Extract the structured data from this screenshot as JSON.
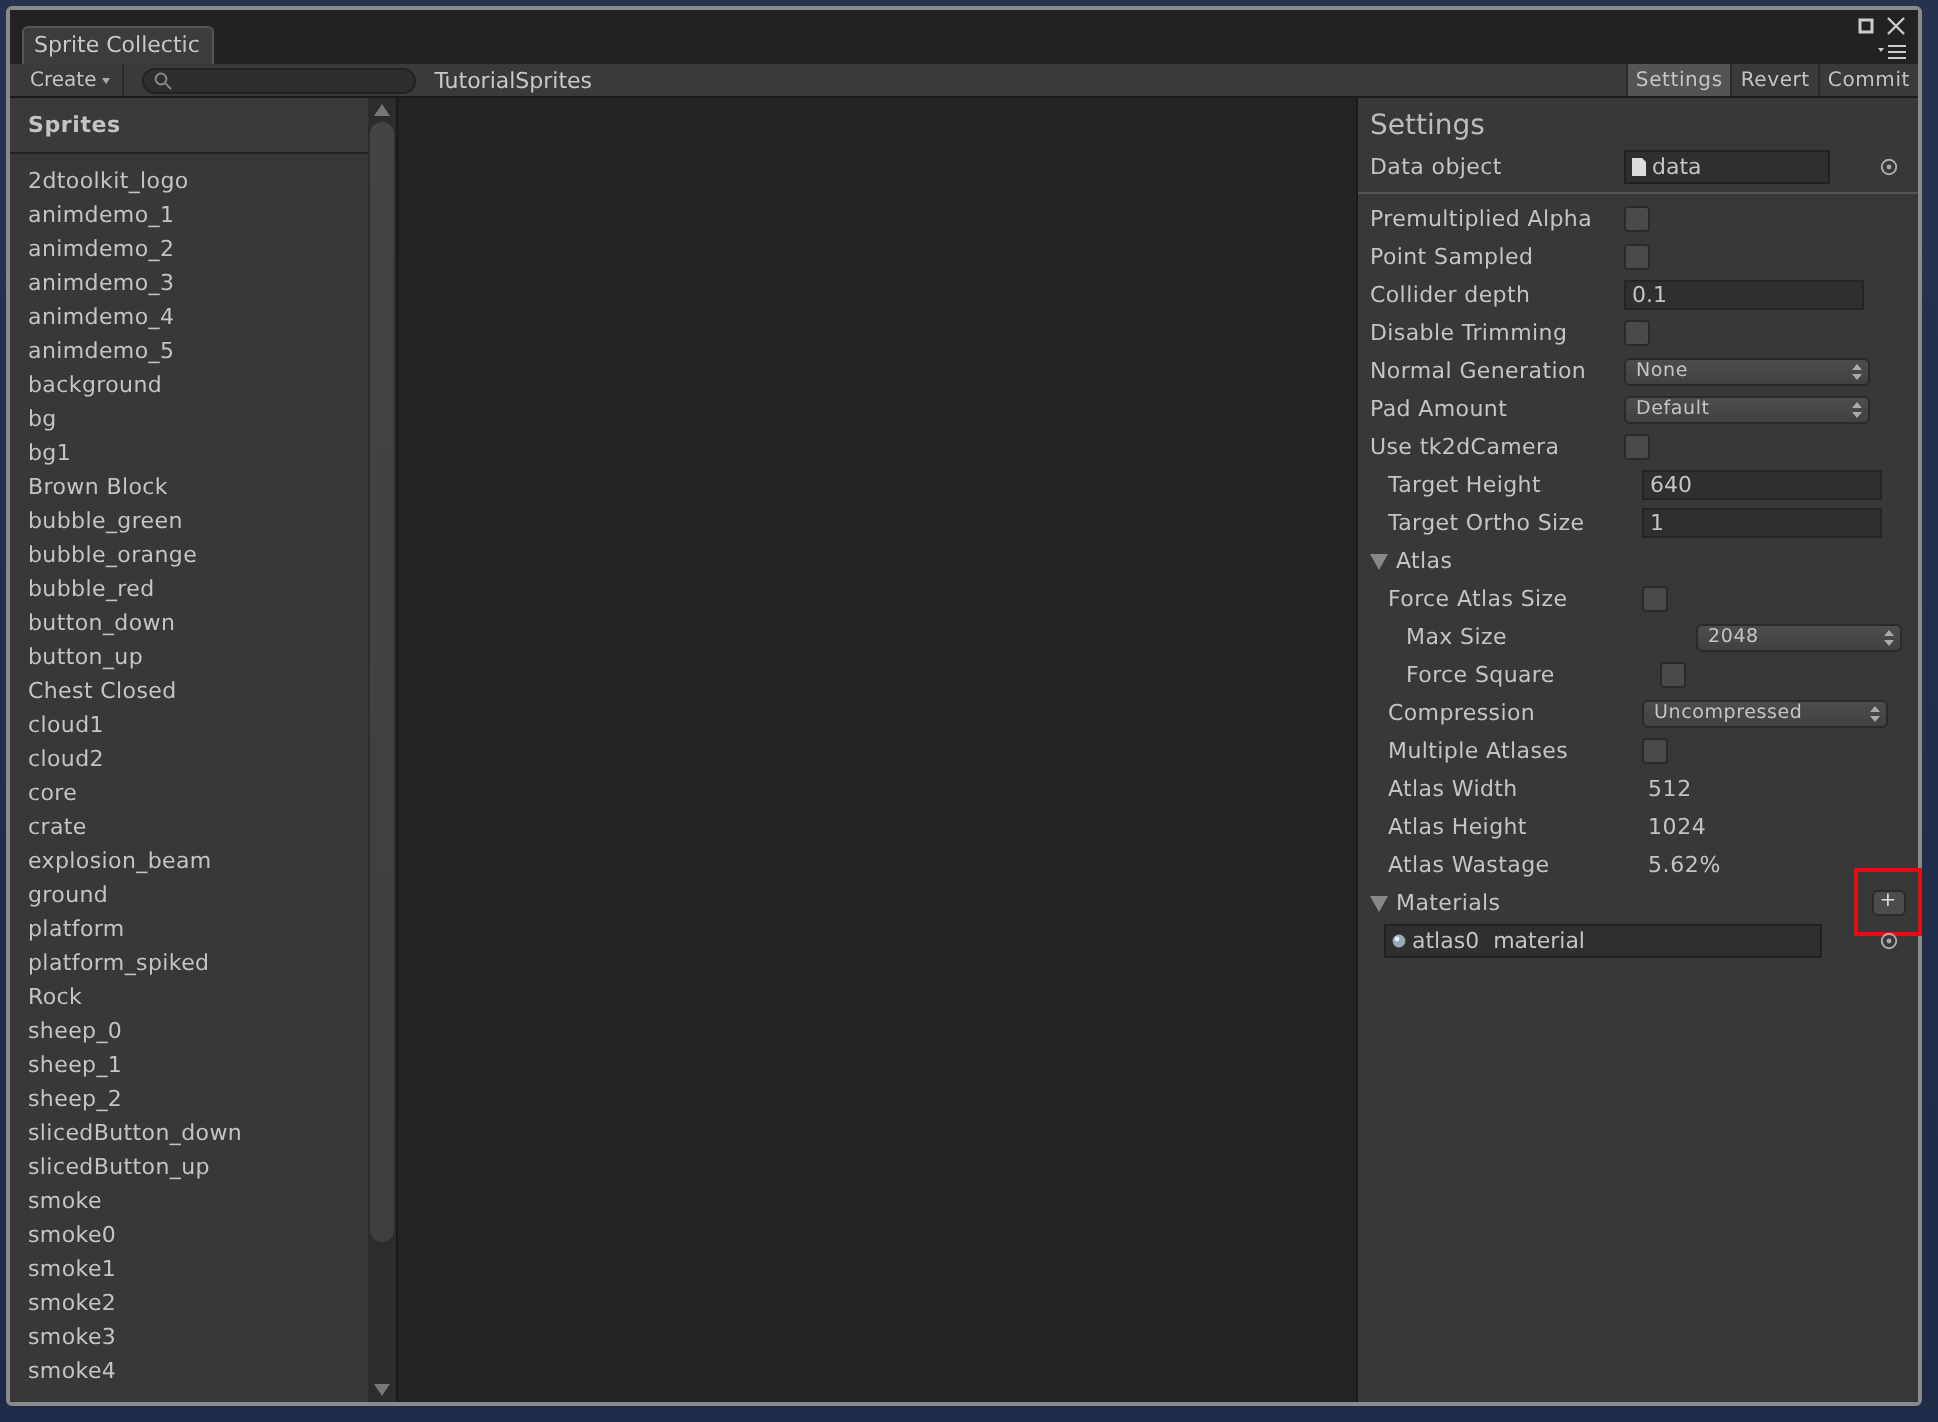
{
  "window": {
    "tab": "Sprite Collectic"
  },
  "toolbar": {
    "create": "Create",
    "collection": "TutorialSprites",
    "buttons": [
      {
        "label": "Settings",
        "selected": true
      },
      {
        "label": "Revert",
        "selected": false
      },
      {
        "label": "Commit",
        "selected": false
      }
    ]
  },
  "sprites": {
    "title": "Sprites",
    "items": [
      "2dtoolkit_logo",
      "animdemo_1",
      "animdemo_2",
      "animdemo_3",
      "animdemo_4",
      "animdemo_5",
      "background",
      "bg",
      "bg1",
      "Brown Block",
      "bubble_green",
      "bubble_orange",
      "bubble_red",
      "button_down",
      "button_up",
      "Chest Closed",
      "cloud1",
      "cloud2",
      "core",
      "crate",
      "explosion_beam",
      "ground",
      "platform",
      "platform_spiked",
      "Rock",
      "sheep_0",
      "sheep_1",
      "sheep_2",
      "slicedButton_down",
      "slicedButton_up",
      "smoke",
      "smoke0",
      "smoke1",
      "smoke2",
      "smoke3",
      "smoke4"
    ]
  },
  "settings": {
    "title": "Settings",
    "data_object": {
      "label": "Data object",
      "value": "data"
    },
    "rows": [
      {
        "kind": "checkbox",
        "label": "Premultiplied Alpha",
        "checked": false
      },
      {
        "kind": "checkbox",
        "label": "Point Sampled",
        "checked": false
      },
      {
        "kind": "field",
        "label": "Collider depth",
        "value": "0.1"
      },
      {
        "kind": "checkbox",
        "label": "Disable Trimming",
        "checked": false
      },
      {
        "kind": "dropdown",
        "label": "Normal Generation",
        "value": "None"
      },
      {
        "kind": "dropdown",
        "label": "Pad Amount",
        "value": "Default"
      },
      {
        "kind": "checkbox",
        "label": "Use tk2dCamera",
        "checked": false,
        "children": [
          {
            "kind": "field",
            "label": "Target Height",
            "value": "640"
          },
          {
            "kind": "field",
            "label": "Target Ortho Size",
            "value": "1"
          }
        ]
      },
      {
        "kind": "section",
        "label": "Atlas",
        "expanded": true,
        "children": [
          {
            "kind": "checkbox",
            "label": "Force Atlas Size",
            "checked": false,
            "children": [
              {
                "kind": "dropdown",
                "label": "Max Size",
                "value": "2048"
              },
              {
                "kind": "checkbox",
                "label": "Force Square",
                "checked": false
              }
            ]
          },
          {
            "kind": "dropdown",
            "label": "Compression",
            "value": "Uncompressed"
          },
          {
            "kind": "checkbox",
            "label": "Multiple Atlases",
            "checked": false
          },
          {
            "kind": "value",
            "label": "Atlas Width",
            "value": "512"
          },
          {
            "kind": "value",
            "label": "Atlas Height",
            "value": "1024"
          },
          {
            "kind": "value",
            "label": "Atlas Wastage",
            "value": "5.62%"
          }
        ]
      },
      {
        "kind": "materials",
        "label": "Materials",
        "expanded": true,
        "add": "+",
        "items": [
          "atlas0  material"
        ]
      }
    ]
  }
}
